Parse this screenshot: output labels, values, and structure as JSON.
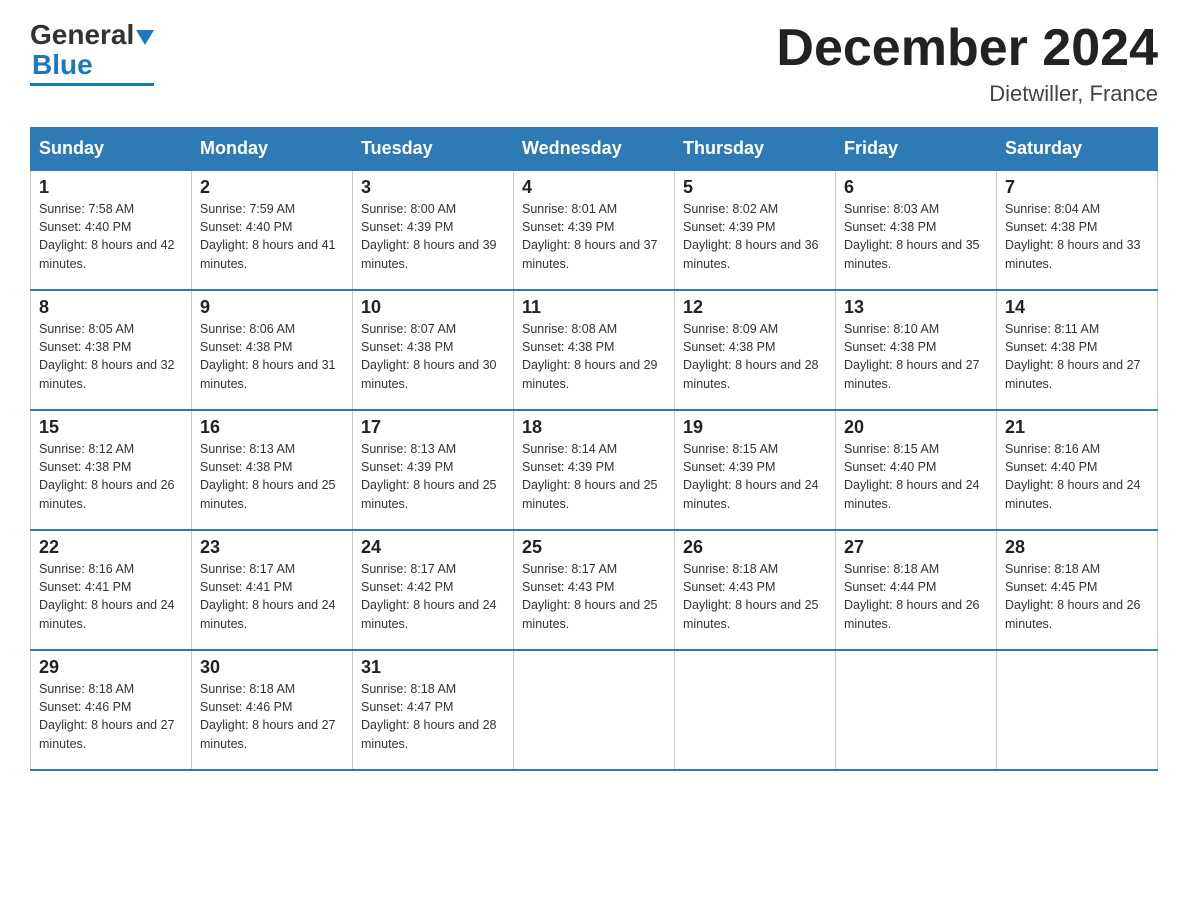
{
  "header": {
    "logo_general": "General",
    "logo_blue": "Blue",
    "title": "December 2024",
    "subtitle": "Dietwiller, France"
  },
  "days_of_week": [
    "Sunday",
    "Monday",
    "Tuesday",
    "Wednesday",
    "Thursday",
    "Friday",
    "Saturday"
  ],
  "weeks": [
    [
      {
        "day": "1",
        "sunrise": "7:58 AM",
        "sunset": "4:40 PM",
        "daylight": "8 hours and 42 minutes."
      },
      {
        "day": "2",
        "sunrise": "7:59 AM",
        "sunset": "4:40 PM",
        "daylight": "8 hours and 41 minutes."
      },
      {
        "day": "3",
        "sunrise": "8:00 AM",
        "sunset": "4:39 PM",
        "daylight": "8 hours and 39 minutes."
      },
      {
        "day": "4",
        "sunrise": "8:01 AM",
        "sunset": "4:39 PM",
        "daylight": "8 hours and 37 minutes."
      },
      {
        "day": "5",
        "sunrise": "8:02 AM",
        "sunset": "4:39 PM",
        "daylight": "8 hours and 36 minutes."
      },
      {
        "day": "6",
        "sunrise": "8:03 AM",
        "sunset": "4:38 PM",
        "daylight": "8 hours and 35 minutes."
      },
      {
        "day": "7",
        "sunrise": "8:04 AM",
        "sunset": "4:38 PM",
        "daylight": "8 hours and 33 minutes."
      }
    ],
    [
      {
        "day": "8",
        "sunrise": "8:05 AM",
        "sunset": "4:38 PM",
        "daylight": "8 hours and 32 minutes."
      },
      {
        "day": "9",
        "sunrise": "8:06 AM",
        "sunset": "4:38 PM",
        "daylight": "8 hours and 31 minutes."
      },
      {
        "day": "10",
        "sunrise": "8:07 AM",
        "sunset": "4:38 PM",
        "daylight": "8 hours and 30 minutes."
      },
      {
        "day": "11",
        "sunrise": "8:08 AM",
        "sunset": "4:38 PM",
        "daylight": "8 hours and 29 minutes."
      },
      {
        "day": "12",
        "sunrise": "8:09 AM",
        "sunset": "4:38 PM",
        "daylight": "8 hours and 28 minutes."
      },
      {
        "day": "13",
        "sunrise": "8:10 AM",
        "sunset": "4:38 PM",
        "daylight": "8 hours and 27 minutes."
      },
      {
        "day": "14",
        "sunrise": "8:11 AM",
        "sunset": "4:38 PM",
        "daylight": "8 hours and 27 minutes."
      }
    ],
    [
      {
        "day": "15",
        "sunrise": "8:12 AM",
        "sunset": "4:38 PM",
        "daylight": "8 hours and 26 minutes."
      },
      {
        "day": "16",
        "sunrise": "8:13 AM",
        "sunset": "4:38 PM",
        "daylight": "8 hours and 25 minutes."
      },
      {
        "day": "17",
        "sunrise": "8:13 AM",
        "sunset": "4:39 PM",
        "daylight": "8 hours and 25 minutes."
      },
      {
        "day": "18",
        "sunrise": "8:14 AM",
        "sunset": "4:39 PM",
        "daylight": "8 hours and 25 minutes."
      },
      {
        "day": "19",
        "sunrise": "8:15 AM",
        "sunset": "4:39 PM",
        "daylight": "8 hours and 24 minutes."
      },
      {
        "day": "20",
        "sunrise": "8:15 AM",
        "sunset": "4:40 PM",
        "daylight": "8 hours and 24 minutes."
      },
      {
        "day": "21",
        "sunrise": "8:16 AM",
        "sunset": "4:40 PM",
        "daylight": "8 hours and 24 minutes."
      }
    ],
    [
      {
        "day": "22",
        "sunrise": "8:16 AM",
        "sunset": "4:41 PM",
        "daylight": "8 hours and 24 minutes."
      },
      {
        "day": "23",
        "sunrise": "8:17 AM",
        "sunset": "4:41 PM",
        "daylight": "8 hours and 24 minutes."
      },
      {
        "day": "24",
        "sunrise": "8:17 AM",
        "sunset": "4:42 PM",
        "daylight": "8 hours and 24 minutes."
      },
      {
        "day": "25",
        "sunrise": "8:17 AM",
        "sunset": "4:43 PM",
        "daylight": "8 hours and 25 minutes."
      },
      {
        "day": "26",
        "sunrise": "8:18 AM",
        "sunset": "4:43 PM",
        "daylight": "8 hours and 25 minutes."
      },
      {
        "day": "27",
        "sunrise": "8:18 AM",
        "sunset": "4:44 PM",
        "daylight": "8 hours and 26 minutes."
      },
      {
        "day": "28",
        "sunrise": "8:18 AM",
        "sunset": "4:45 PM",
        "daylight": "8 hours and 26 minutes."
      }
    ],
    [
      {
        "day": "29",
        "sunrise": "8:18 AM",
        "sunset": "4:46 PM",
        "daylight": "8 hours and 27 minutes."
      },
      {
        "day": "30",
        "sunrise": "8:18 AM",
        "sunset": "4:46 PM",
        "daylight": "8 hours and 27 minutes."
      },
      {
        "day": "31",
        "sunrise": "8:18 AM",
        "sunset": "4:47 PM",
        "daylight": "8 hours and 28 minutes."
      },
      null,
      null,
      null,
      null
    ]
  ]
}
